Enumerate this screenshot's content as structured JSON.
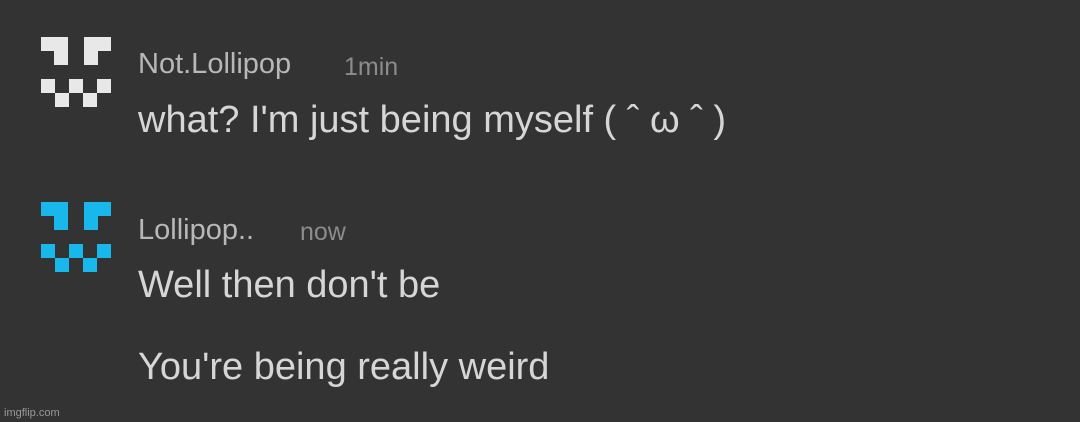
{
  "colors": {
    "background": "#333333",
    "avatar_gray": "#e8e8e8",
    "avatar_blue": "#19b8ec",
    "username": "#b8b8b8",
    "timestamp": "#8c8c8c",
    "message_text": "#d6d6d6"
  },
  "messages": [
    {
      "avatar_icon": "pixel-face-icon",
      "avatar_color": "#e8e8e8",
      "username": "Not.Lollipop",
      "timestamp": "1min",
      "lines": [
        "what? I'm just being myself (  ˆ ω ˆ  )"
      ]
    },
    {
      "avatar_icon": "pixel-face-icon",
      "avatar_color": "#19b8ec",
      "username": "Lollipop..",
      "timestamp": "now",
      "lines": [
        "Well then don't be",
        "You're being really weird"
      ]
    }
  ],
  "watermark": "imgflip.com"
}
